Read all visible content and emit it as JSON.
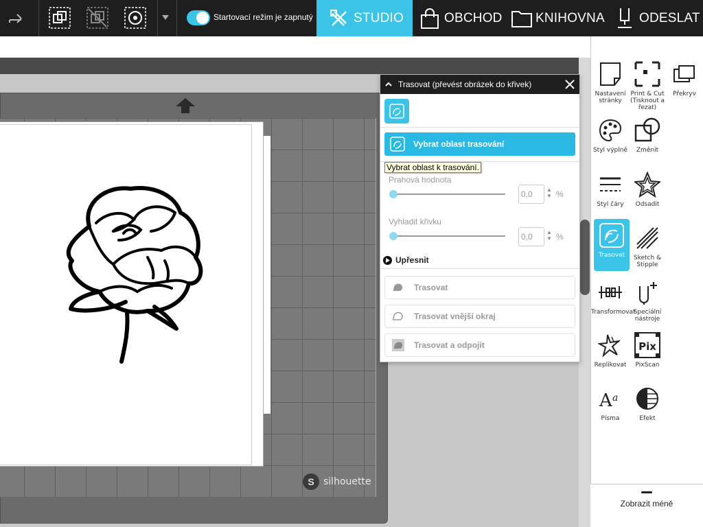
{
  "topbar": {
    "toggle_label": "Startovací režim je zapnutý",
    "tabs": [
      {
        "label": "STUDIO",
        "icon": "studio-icon",
        "active": true
      },
      {
        "label": "OBCHOD",
        "icon": "shopping-bag-icon",
        "active": false
      },
      {
        "label": "KNIHOVNA",
        "icon": "folder-icon",
        "active": false
      },
      {
        "label": "ODESLAT",
        "icon": "send-cutter-icon",
        "active": false
      }
    ],
    "accent_color": "#3bc3e8"
  },
  "canvas": {
    "brand_text": "silhouette"
  },
  "trace_panel": {
    "title": "Trasovat (převést obrázek do křivek)",
    "select_area_label": "Vybrat oblast trasování",
    "tooltip": "Vybrat oblast k trasování.",
    "threshold_label": "Prahová hodnota",
    "threshold_value": "0,0",
    "smooth_label": "Vyhladit křivku",
    "smooth_value": "0,0",
    "unit": "%",
    "refine_label": "Upřesnit",
    "actions": [
      "Trasovat",
      "Trasovat vnější okraj",
      "Trasovat a odpojit"
    ]
  },
  "sidebar": {
    "tools": [
      {
        "label": "Nastavení stránky",
        "icon": "page-setup-icon"
      },
      {
        "label": "Print & Cut (Tisknout a řezat)",
        "icon": "print-cut-icon"
      },
      {
        "label": "Překryv",
        "icon": "overlay-icon"
      },
      {
        "label": "Styl výplně",
        "icon": "fill-palette-icon"
      },
      {
        "label": "Změnit",
        "icon": "modify-icon"
      },
      {
        "label": "Styl čáry",
        "icon": "line-style-icon"
      },
      {
        "label": "Odsadit",
        "icon": "offset-star-icon"
      },
      {
        "label": "Trasovat",
        "icon": "trace-icon",
        "active": true
      },
      {
        "label": "Sketch & Stipple",
        "icon": "sketch-icon"
      },
      {
        "label": "Transformovat",
        "icon": "transform-icon"
      },
      {
        "label": "Speciální nástroje",
        "icon": "special-tools-icon"
      },
      {
        "label": "Replikovat",
        "icon": "replicate-icon"
      },
      {
        "label": "PixScan",
        "icon": "pixscan-icon"
      },
      {
        "label": "Písma",
        "icon": "fonts-icon"
      },
      {
        "label": "Efekt",
        "icon": "effect-icon"
      }
    ],
    "show_less": "Zobrazit méně"
  }
}
